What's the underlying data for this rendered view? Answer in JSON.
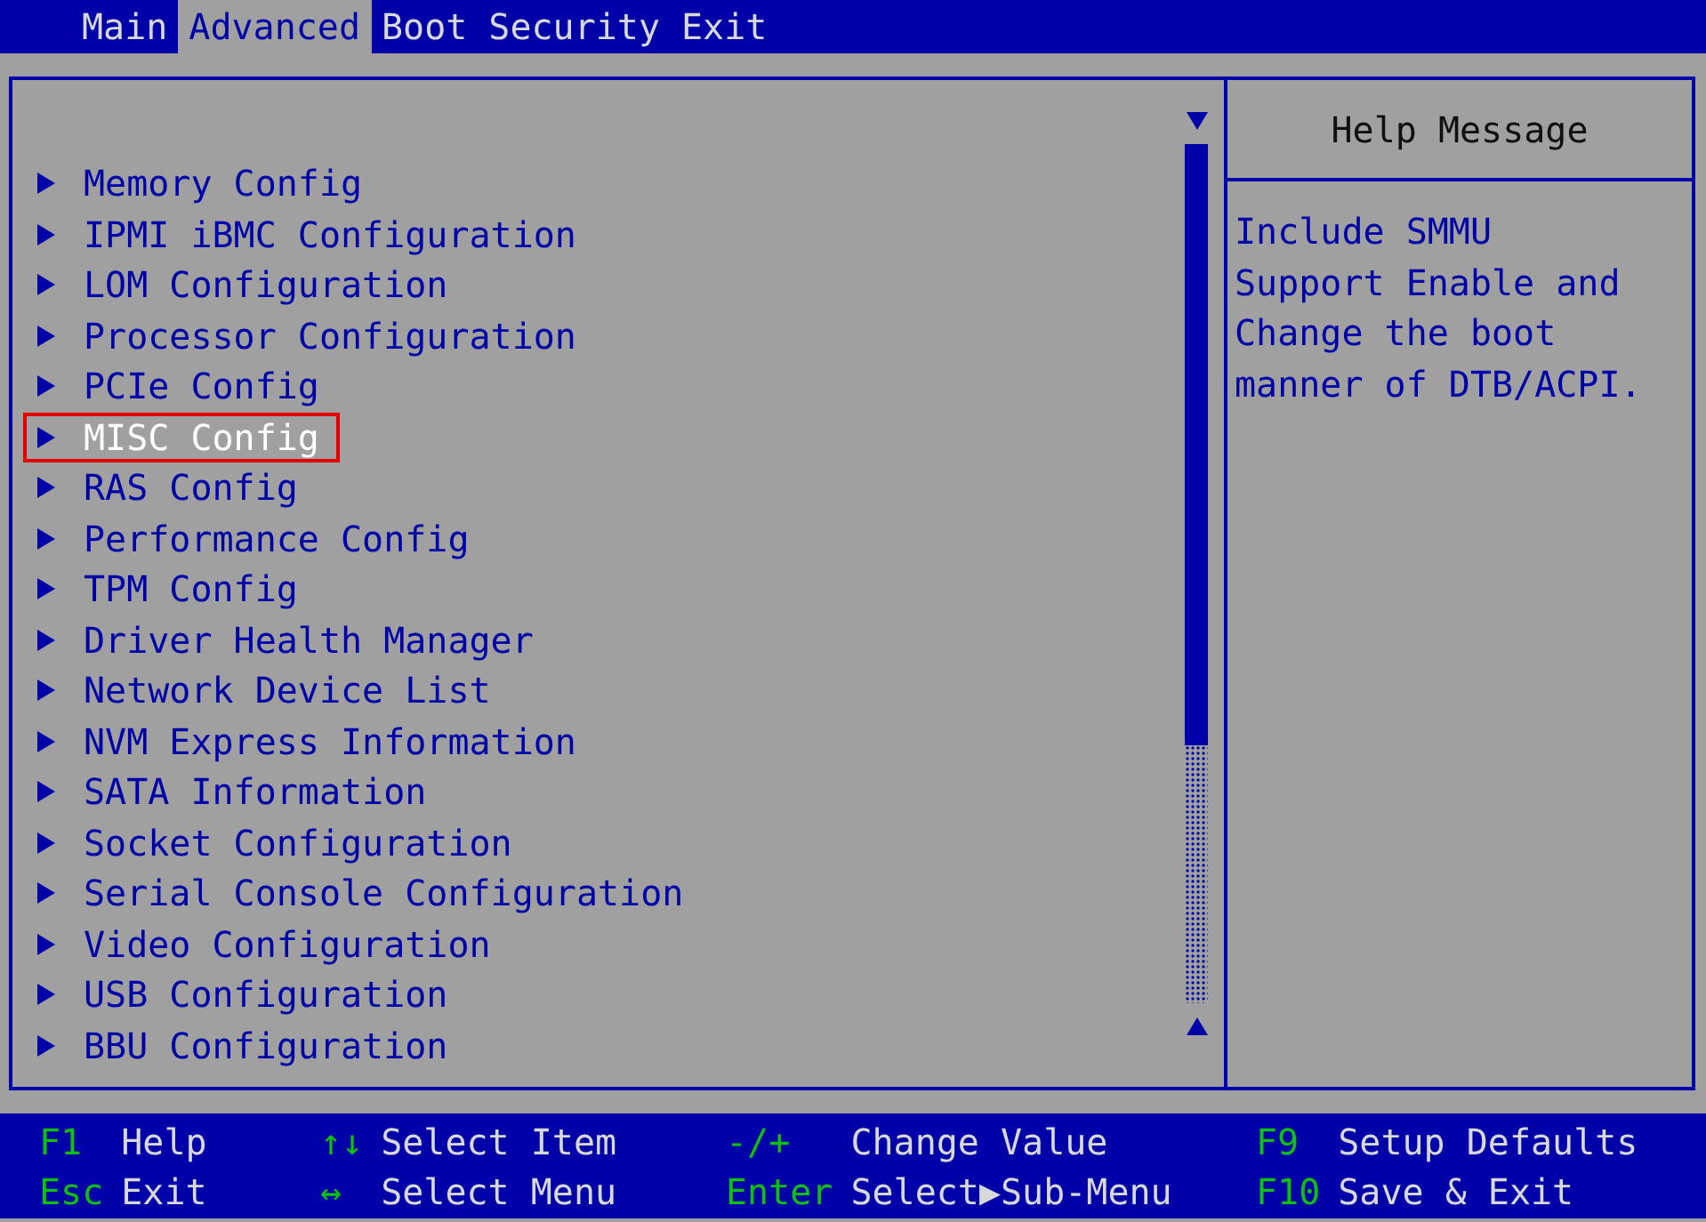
{
  "tabs": [
    {
      "label": "Main",
      "selected": false
    },
    {
      "label": "Advanced",
      "selected": true
    },
    {
      "label": "Boot",
      "selected": false
    },
    {
      "label": "Security",
      "selected": false
    },
    {
      "label": "Exit",
      "selected": false
    }
  ],
  "menu": {
    "items": [
      {
        "label": "Memory Config",
        "selected": false
      },
      {
        "label": "IPMI iBMC Configuration",
        "selected": false
      },
      {
        "label": "LOM Configuration",
        "selected": false
      },
      {
        "label": "Processor Configuration",
        "selected": false
      },
      {
        "label": "PCIe Config",
        "selected": false
      },
      {
        "label": "MISC Config",
        "selected": true
      },
      {
        "label": "RAS Config",
        "selected": false
      },
      {
        "label": "Performance Config",
        "selected": false
      },
      {
        "label": "TPM Config",
        "selected": false
      },
      {
        "label": "Driver Health Manager",
        "selected": false
      },
      {
        "label": "Network Device List",
        "selected": false
      },
      {
        "label": "NVM Express Information",
        "selected": false
      },
      {
        "label": "SATA Information",
        "selected": false
      },
      {
        "label": "Socket Configuration",
        "selected": false
      },
      {
        "label": "Serial Console Configuration",
        "selected": false
      },
      {
        "label": "Video Configuration",
        "selected": false
      },
      {
        "label": "USB Configuration",
        "selected": false
      },
      {
        "label": "BBU Configuration",
        "selected": false
      }
    ]
  },
  "help": {
    "title": "Help Message",
    "text": "Include SMMU Support Enable and Change the boot manner of DTB/ACPI."
  },
  "status_bar": [
    {
      "key": "F1",
      "action": "Help"
    },
    {
      "key": "Esc",
      "action": "Exit"
    },
    {
      "key": "↑↓",
      "action": "Select Item"
    },
    {
      "key": "↔",
      "action": "Select Menu"
    },
    {
      "key": "-/+",
      "action": "Change Value"
    },
    {
      "key": "Enter",
      "action": "Select▶Sub-Menu"
    },
    {
      "key": "F9",
      "action": "Setup Defaults"
    },
    {
      "key": "F10",
      "action": "Save & Exit"
    }
  ]
}
